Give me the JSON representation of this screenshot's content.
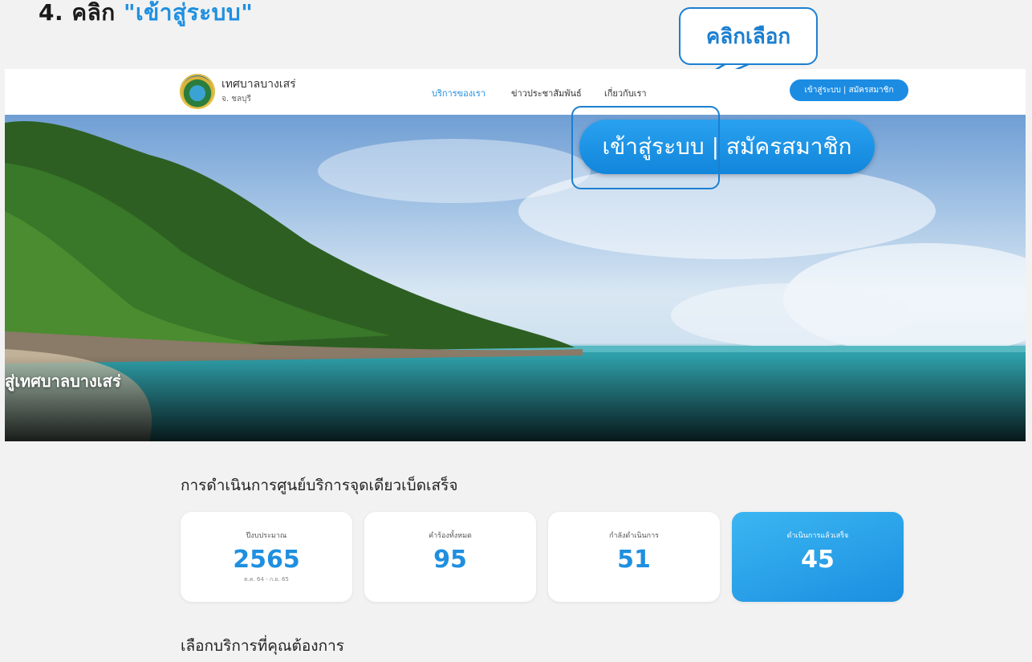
{
  "instruction": {
    "prefix": "4. คลิก ",
    "highlight": "\"เข้าสู่ระบบ\""
  },
  "callout": {
    "text": "คลิกเลือก"
  },
  "header": {
    "brand_name": "เทศบาลบางเสร่",
    "brand_sub": "จ. ชลบุรี",
    "nav": [
      "บริการของเรา",
      "ข่าวประชาสัมพันธ์",
      "เกี่ยวกับเรา"
    ],
    "login_label": "เข้าสู่ระบบ | สมัครสมาชิก"
  },
  "hero": {
    "login_label": "เข้าสู่ระบบ | สมัครสมาชิก",
    "caption": "สู่เทศบาลบางเสร่"
  },
  "stats": {
    "title": "การดำเนินการศูนย์บริการจุดเดียวเบ็ดเสร็จ",
    "cards": [
      {
        "label": "ปีงบประมาณ",
        "value": "2565",
        "note": "ต.ค. 64 - ก.ย. 65"
      },
      {
        "label": "คำร้องทั้งหมด",
        "value": "95"
      },
      {
        "label": "กำลังดำเนินการ",
        "value": "51"
      },
      {
        "label": "ดำเนินการแล้วเสร็จ",
        "value": "45"
      }
    ]
  },
  "services": {
    "title": "เลือกบริการที่คุณต้องการ"
  },
  "colors": {
    "accent": "#1f8fe0",
    "callout_border": "#1b7fd1"
  }
}
